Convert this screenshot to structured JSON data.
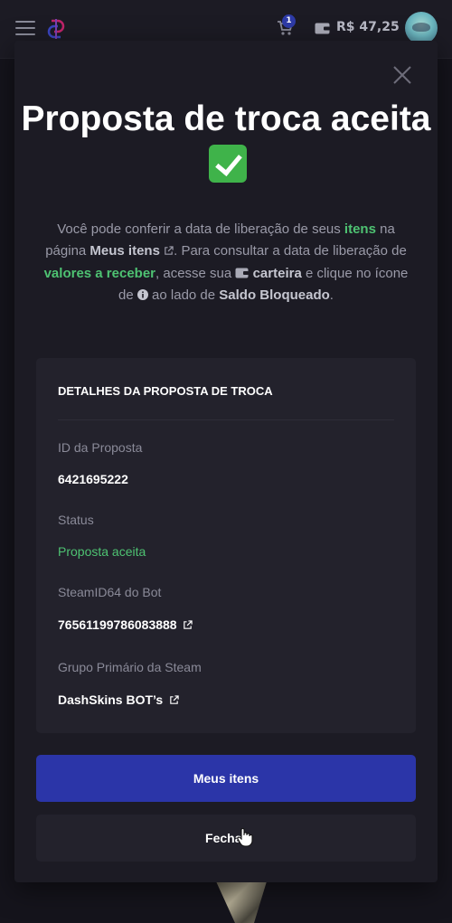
{
  "navbar": {
    "cart_count": "1",
    "balance": "R$ 47,25"
  },
  "modal": {
    "title": "Proposta de troca aceita",
    "description": {
      "part1": "Você pode conferir a data de liberação de seus ",
      "link_itens": "itens",
      "part2": " na página ",
      "meus_itens": "Meus itens",
      "part3": ". Para consultar a data de liberação de ",
      "link_valores": "valores a receber",
      "part4": ", acesse sua ",
      "carteira": "carteira",
      "part5": " e clique no ícone de ",
      "part6": " ao lado de ",
      "saldo_bloqueado": "Saldo Bloqueado",
      "part7": "."
    },
    "details": {
      "title": "DETALHES DA PROPOSTA DE TROCA",
      "fields": [
        {
          "label": "ID da Proposta",
          "value": "6421695222"
        },
        {
          "label": "Status",
          "value": "Proposta aceita"
        },
        {
          "label": "SteamID64 do Bot",
          "value": "76561199786083888"
        },
        {
          "label": "Grupo Primário da Steam",
          "value": "DashSkins BOT’s"
        }
      ]
    },
    "buttons": {
      "primary": "Meus itens",
      "secondary": "Fechar"
    }
  },
  "icons": {
    "menu": "hamburger-menu-icon",
    "logo": "dashskins-logo",
    "cart": "cart-icon",
    "wallet": "wallet-icon",
    "close": "close-icon",
    "check": "check-emoji-icon",
    "external": "external-link-icon",
    "info": "info-icon",
    "cursor": "hand-cursor-icon"
  },
  "colors": {
    "accent_green": "#4ec272",
    "primary_button": "#2b35a8",
    "background": "#1c1b24"
  }
}
